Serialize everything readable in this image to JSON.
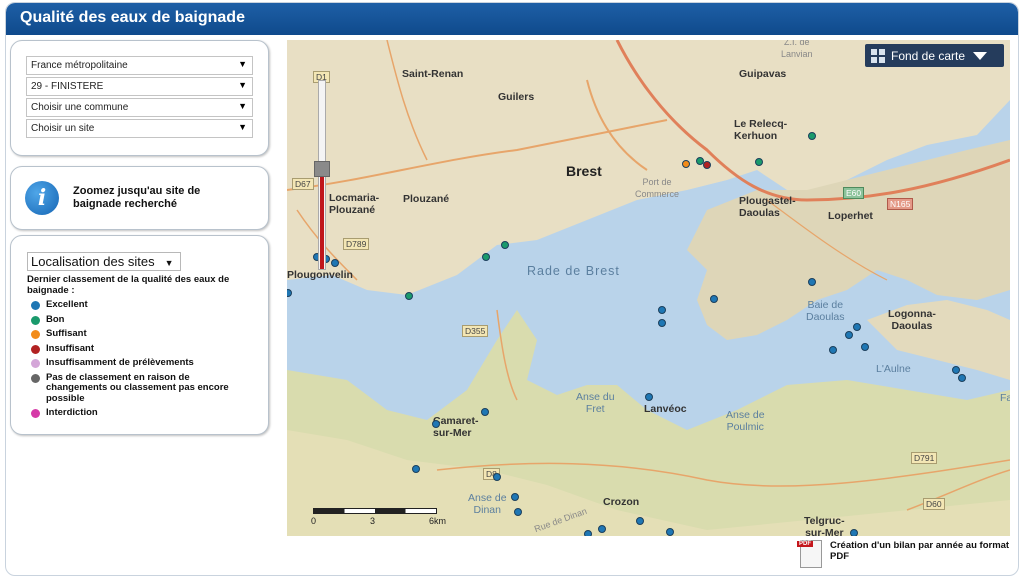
{
  "header": {
    "title": "Qualité des eaux de baignade"
  },
  "selects": [
    {
      "value": "France métropolitaine"
    },
    {
      "value": "29 - FINISTERE"
    },
    {
      "value": "Choisir une commune"
    },
    {
      "value": "Choisir un site"
    }
  ],
  "info": {
    "text": "Zoomez jusqu'au site de baignade recherché"
  },
  "legend": {
    "select_value": "Localisation des sites",
    "title": "Dernier classement de la qualité des eaux de baignade :",
    "items": [
      {
        "label": "Excellent",
        "color": "#1f77b4"
      },
      {
        "label": "Bon",
        "color": "#1a9a6c"
      },
      {
        "label": "Suffisant",
        "color": "#f28c1a"
      },
      {
        "label": "Insuffisant",
        "color": "#b22222"
      },
      {
        "label": "Insuffisamment de prélèvements",
        "color": "#d4a6d8"
      },
      {
        "label": "Pas de classement en raison de changements ou classement pas encore possible",
        "color": "#666666"
      },
      {
        "label": "Interdiction",
        "color": "#d63aa8"
      }
    ]
  },
  "map": {
    "basemap_button": "Fond de carte",
    "places": {
      "saint_renan": "Saint-Renan",
      "guilers": "Guilers",
      "guipavas": "Guipavas",
      "lanvian": "Z.I. de\nLanvian",
      "relecq": "Le Relecq-\nKerhuon",
      "brest": "Brest",
      "port_commerce": "Port de\nCommerce",
      "locmaria": "Locmaria-\nPlouzané",
      "plouzane": "Plouzané",
      "plougastel": "Plougastel-\nDaoulas",
      "loperhet": "Loperhet",
      "plougonvelin": "Plougonvelin",
      "rade": "Rade de Brest",
      "baie_daoulas": "Baie de\nDaoulas",
      "logonna": "Logonna-\nDaoulas",
      "aulne": "L'Aulne",
      "anse_fret": "Anse du\nFret",
      "lanveoc": "Lanvéoc",
      "anse_poulmic": "Anse de\nPoulmic",
      "camaret": "Camaret-\nsur-Mer",
      "anse_dinan": "Anse de\nDinan",
      "crozon": "Crozon",
      "telgruc": "Telgruc-\nsur-Mer",
      "rue_dinan": "Rue de Dinan",
      "fa": "Fa"
    },
    "roads": {
      "d67": "D67",
      "d789": "D789",
      "d355": "D355",
      "e60": "E60",
      "n165": "N165",
      "d791": "D791",
      "d60": "D60",
      "d8": "D8",
      "d1": "D1"
    },
    "scale": {
      "labels": [
        "0",
        "3",
        "6km"
      ]
    }
  },
  "pdf": {
    "text": "Création d'un bilan par année au format PDF",
    "icon_tag": "PDF"
  }
}
